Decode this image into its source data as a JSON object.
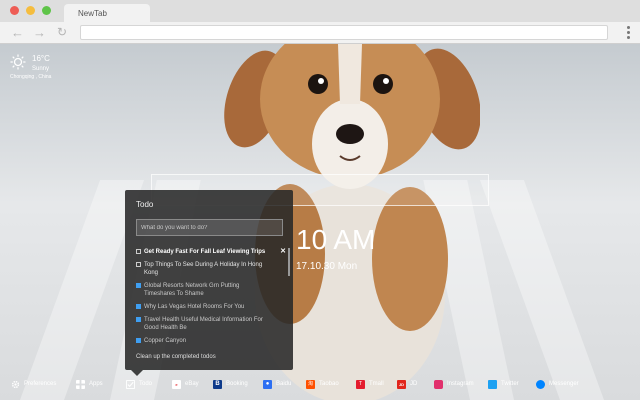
{
  "browser": {
    "tab_title": "NewTab",
    "back_icon": "arrow-left-icon",
    "forward_icon": "arrow-right-icon",
    "reload_icon": "reload-icon",
    "menu_icon": "menu-dots-icon"
  },
  "weather": {
    "icon": "sun-cloud-icon",
    "temperature": "16°C",
    "condition": "Sunny",
    "location": "Chongqing , China"
  },
  "clock": {
    "time": "10 AM",
    "date": "17.10.30 Mon"
  },
  "todo": {
    "title": "Todo",
    "input_placeholder": "What do you want to do?",
    "items": [
      {
        "text": "Get Ready Fast For Fall Leaf Viewing Trips",
        "done": false
      },
      {
        "text": "Top Things To See During A Holiday In Hong Kong",
        "done": false
      },
      {
        "text": "Global Resorts Network Grn Putting Timeshares To Shame",
        "done": true
      },
      {
        "text": "Why Las Vegas Hotel Rooms For You",
        "done": true
      },
      {
        "text": "Travel Health Useful Medical Information For Good Health Be",
        "done": true
      },
      {
        "text": "Copper Canyon",
        "done": true
      }
    ],
    "delete_icon": "close-icon",
    "clear_label": "Clean up the completed todos"
  },
  "bottom_bar": [
    {
      "label": "Preferences",
      "icon": "gear-icon",
      "color": "#ffffff"
    },
    {
      "label": "Apps",
      "icon": "grid-icon",
      "color": "#ffffff"
    },
    {
      "label": "Todo",
      "icon": "checkbox-icon",
      "color": "#ffffff"
    },
    {
      "label": "eBay",
      "icon": "ebay-icon",
      "color": "#ffffff"
    },
    {
      "label": "Booking",
      "icon": "booking-icon",
      "color": "#0e3a8a"
    },
    {
      "label": "Baidu",
      "icon": "baidu-icon",
      "color": "#2d6ff2"
    },
    {
      "label": "Taobao",
      "icon": "taobao-icon",
      "color": "#ff5000"
    },
    {
      "label": "Tmall",
      "icon": "tmall-icon",
      "color": "#e41c2d"
    },
    {
      "label": "JD",
      "icon": "jd-icon",
      "color": "#e1251b"
    },
    {
      "label": "Instagram",
      "icon": "instagram-icon",
      "color": "#e1306c"
    },
    {
      "label": "Twitter",
      "icon": "twitter-icon",
      "color": "#1da1f2"
    },
    {
      "label": "Messenger",
      "icon": "messenger-icon",
      "color": "#0084ff"
    }
  ]
}
